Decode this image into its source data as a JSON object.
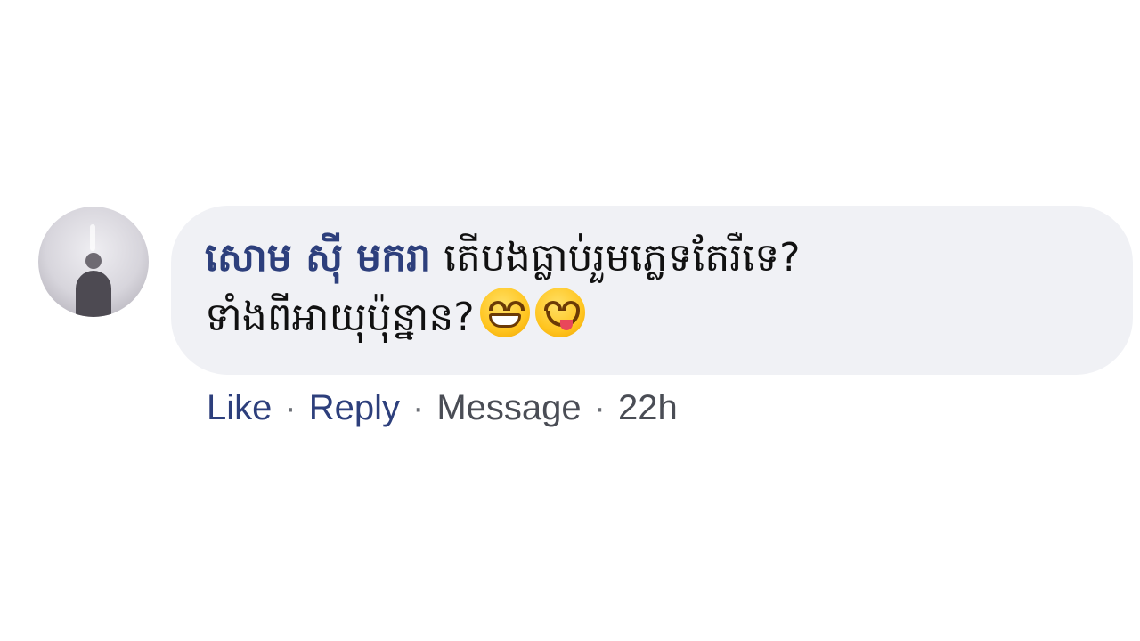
{
  "comment": {
    "author": "សោម ស៊ី មករា",
    "text_line1": "តើបងធ្លាប់រួមភ្លេទតែរឺទេ?",
    "text_line2": "ទាំងពីអាយុប៉ុន្នាន?",
    "emojis": [
      "grinning-face-icon",
      "face-savoring-food-icon"
    ],
    "colors": {
      "author": "#2d3f7c",
      "bubble": "#f0f1f5",
      "link": "#2d3f7c",
      "meta": "#4a4d55"
    }
  },
  "actions": {
    "like": "Like",
    "reply": "Reply",
    "message": "Message",
    "time": "22h",
    "separator": "·"
  }
}
